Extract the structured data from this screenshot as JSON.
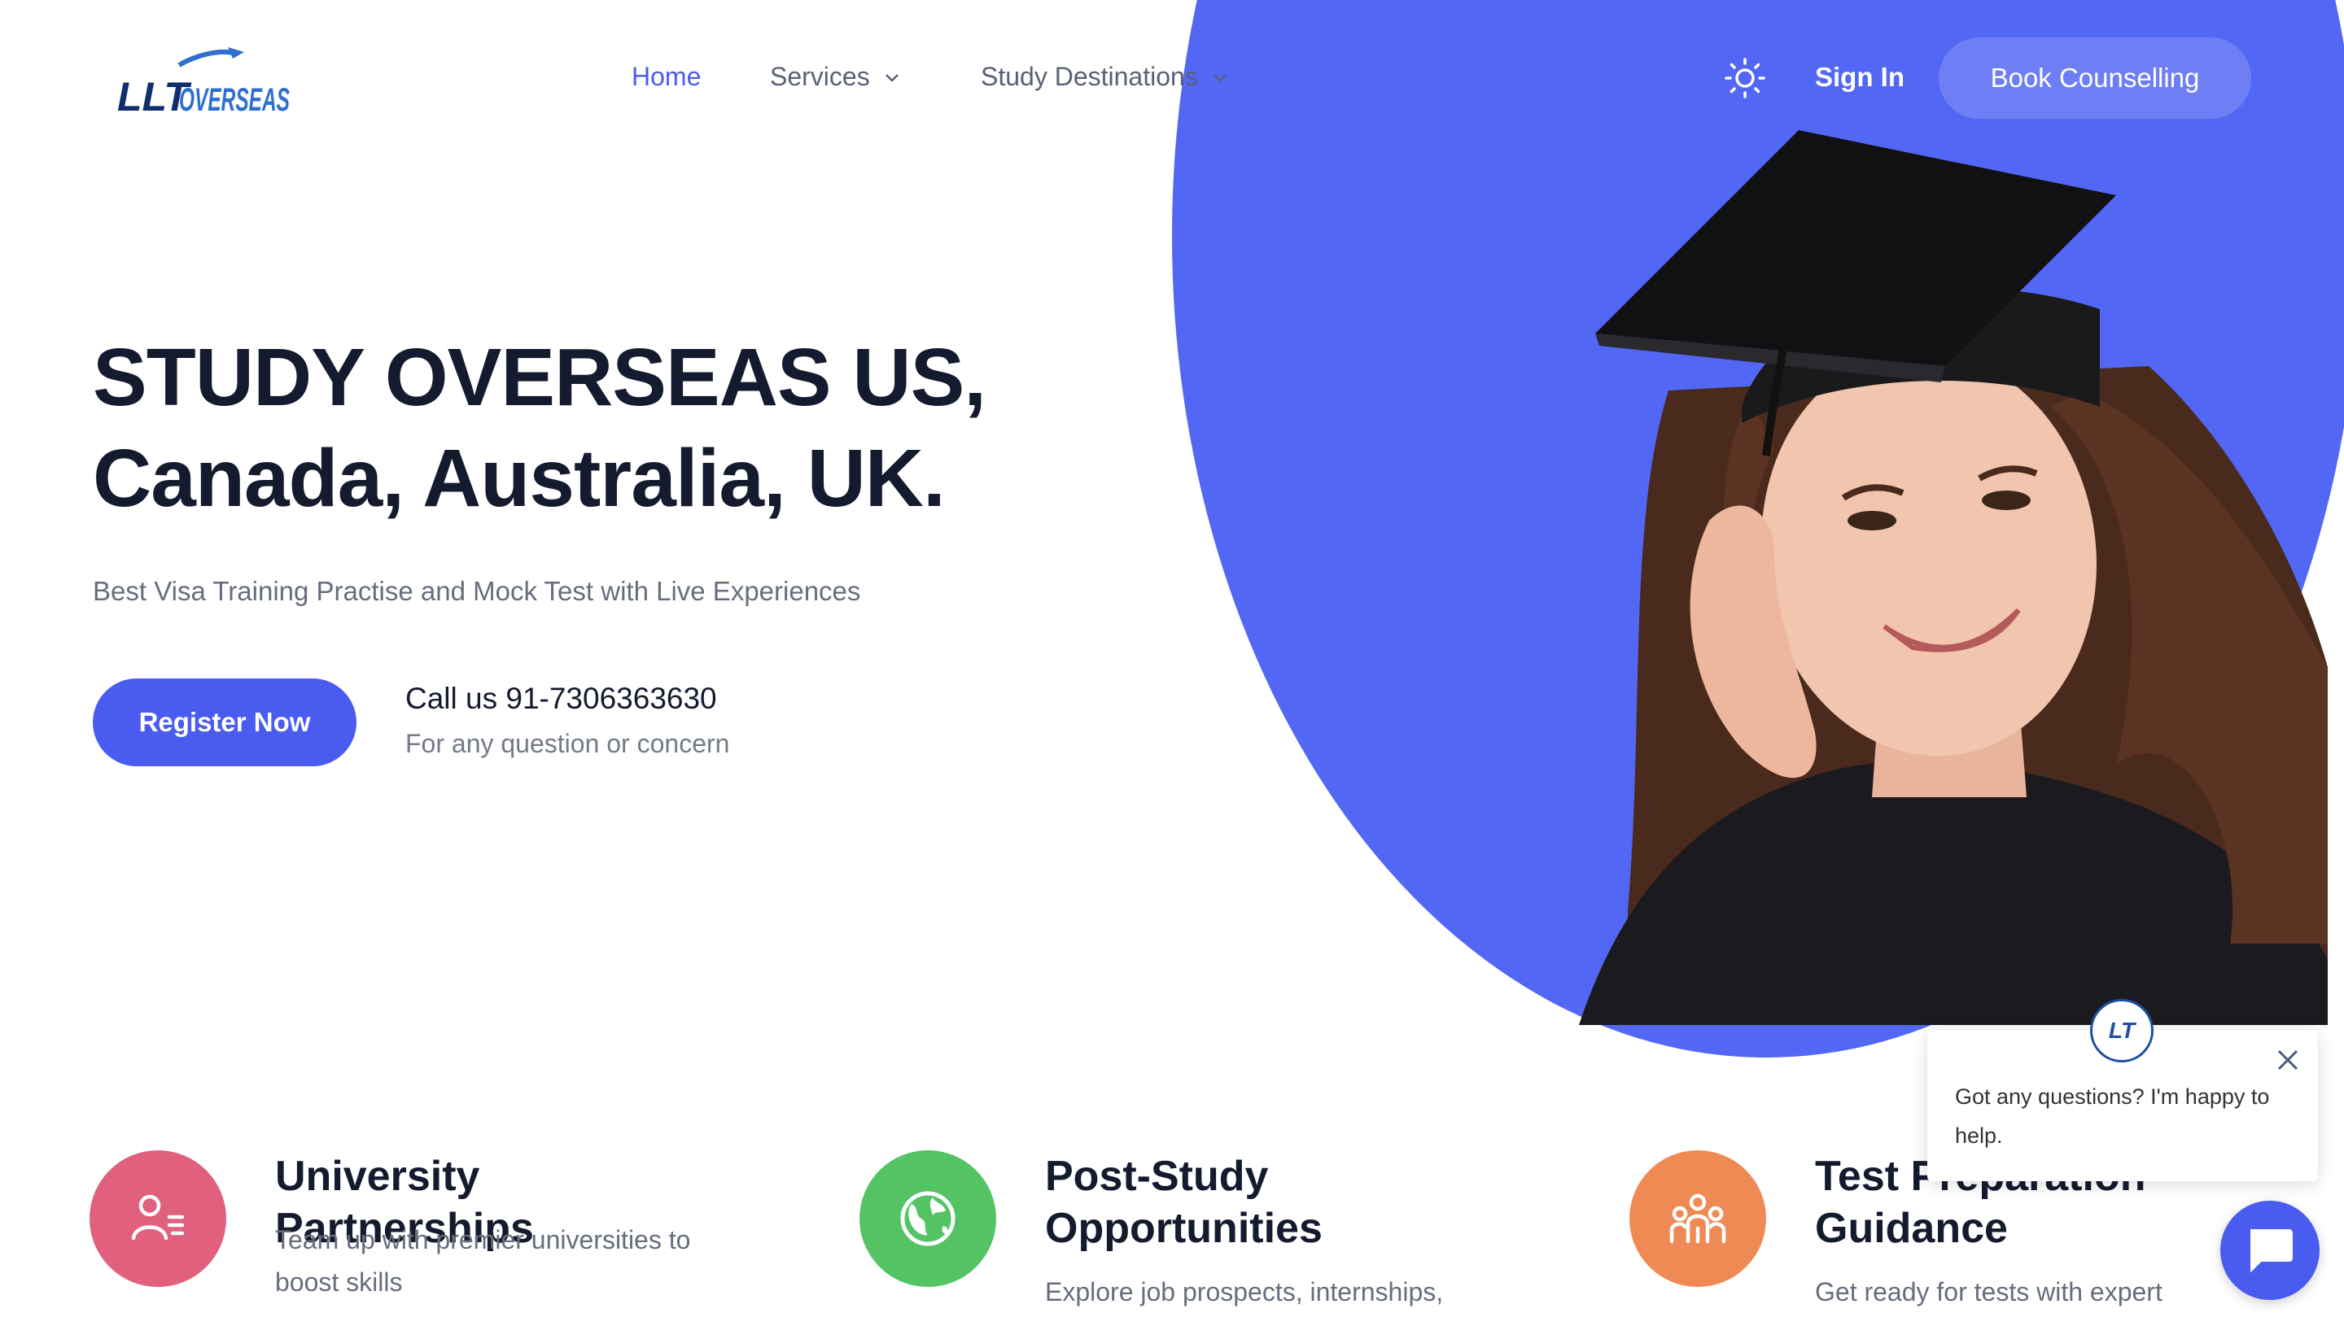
{
  "brand": {
    "logo_text_main": "LLT",
    "logo_text_sub": "OVERSEAS"
  },
  "nav": {
    "home": "Home",
    "services": "Services",
    "study_destinations": "Study Destinations",
    "sign_in": "Sign In",
    "book_counselling": "Book Counselling"
  },
  "hero": {
    "title_line1": "STUDY OVERSEAS US,",
    "title_line2": "Canada, Australia, UK.",
    "subtitle": "Best Visa Training Practise and Mock Test with Live Experiences",
    "register_button": "Register Now",
    "call_title": "Call us 91-7306363630",
    "call_subtitle": "For any question or concern"
  },
  "features": [
    {
      "title": "University Partnerships",
      "description": "Team up with premier universities to boost skills",
      "icon": "user-list-icon",
      "color": "#e0607e"
    },
    {
      "title": "Post-Study Opportunities",
      "description": "Explore job prospects, internships,",
      "icon": "globe-icon",
      "color": "#54c364"
    },
    {
      "title": "Test Preparation Guidance",
      "description": "Get ready for tests with expert",
      "icon": "group-icon",
      "color": "#ef8a55"
    }
  ],
  "chat": {
    "message": "Got any questions? I'm happy to help.",
    "avatar_text": "LT"
  },
  "colors": {
    "primary": "#4a5cf0",
    "hero_blob": "#5367f5",
    "heading": "#151b2e"
  }
}
